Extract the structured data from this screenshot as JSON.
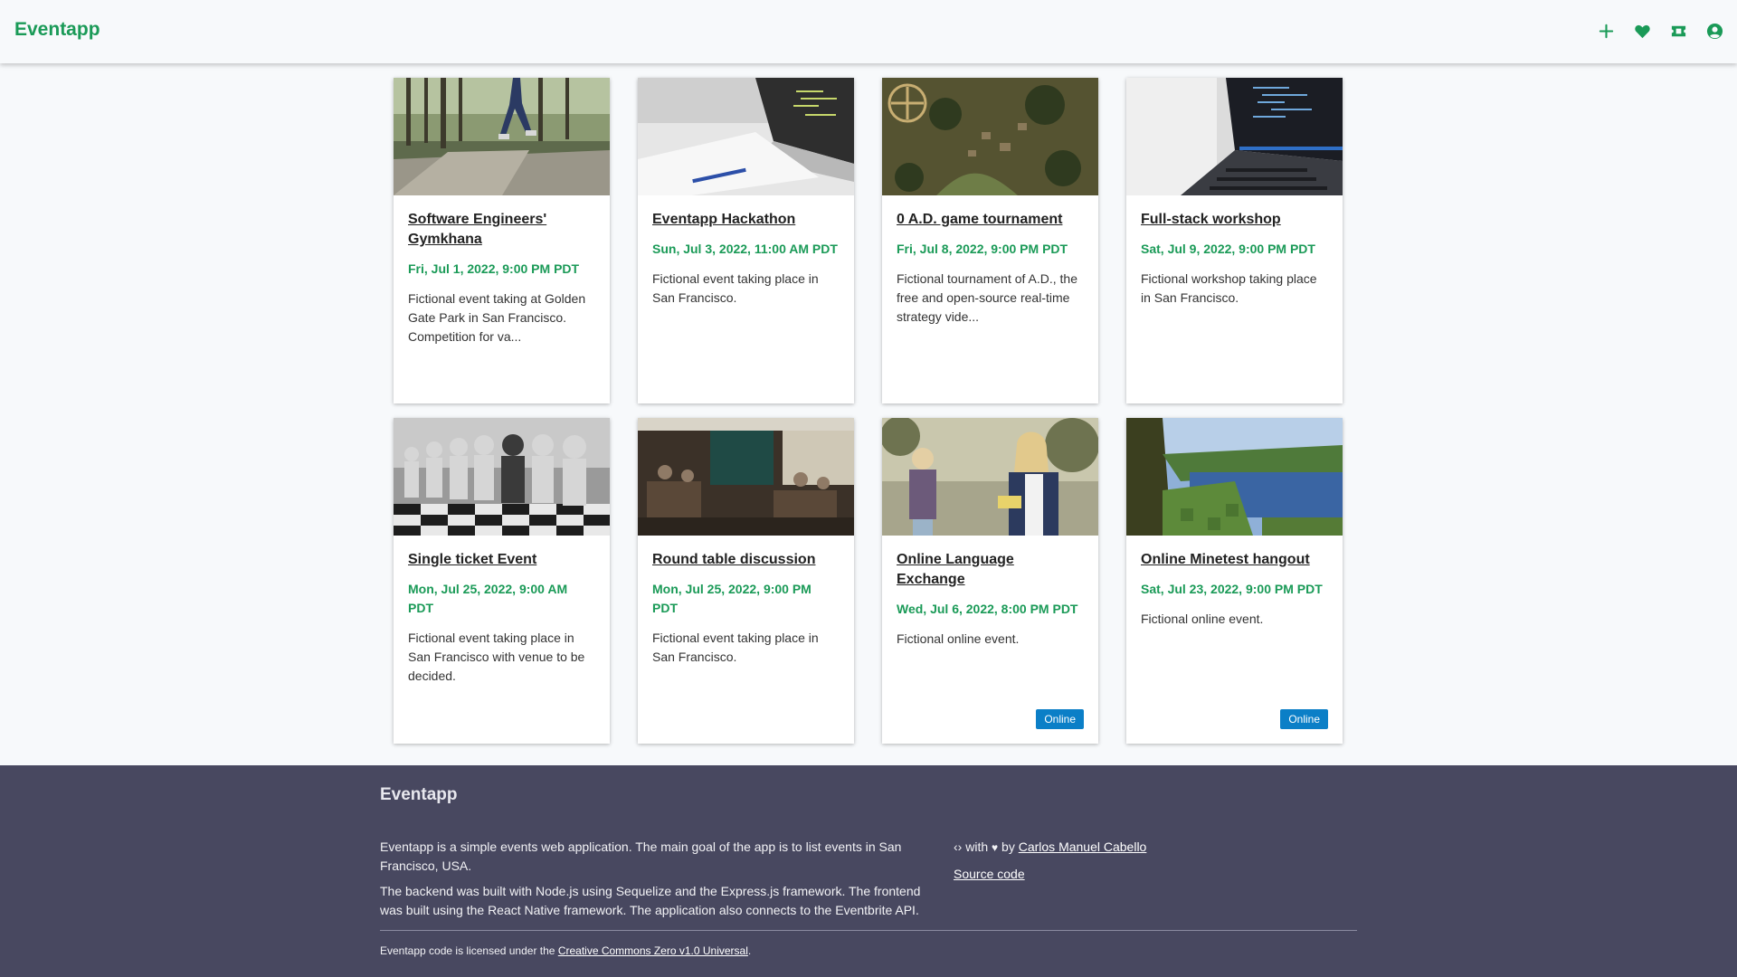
{
  "header": {
    "brand": "Eventapp",
    "icons": [
      "plus-icon",
      "heart-icon",
      "ticket-icon",
      "user-circle-icon"
    ]
  },
  "colors": {
    "accent": "#1a9a57",
    "badge": "#0b7fc7",
    "footer_bg": "#484860"
  },
  "events": [
    {
      "title": "Software Engineers' Gymkhana",
      "date": "Fri, Jul 1, 2022, 9:00 PM PDT",
      "description": "Fictional event taking at Golden Gate Park in San Francisco. Competition for va...",
      "badge": "",
      "image": "park-runner-image"
    },
    {
      "title": "Eventapp Hackathon",
      "date": "Sun, Jul 3, 2022, 11:00 AM PDT",
      "description": "Fictional event taking place in San Francisco.",
      "badge": "",
      "image": "laptop-notebook-image"
    },
    {
      "title": "0 A.D. game tournament",
      "date": "Fri, Jul 8, 2022, 9:00 PM PDT",
      "description": "Fictional tournament  of A.D., the free and open-source real-time strategy vide...",
      "badge": "",
      "image": "strategy-game-image"
    },
    {
      "title": "Full-stack workshop",
      "date": "Sat, Jul 9, 2022, 9:00 PM PDT",
      "description": "Fictional workshop taking place in San Francisco.",
      "badge": "",
      "image": "laptop-code-image"
    },
    {
      "title": "Single ticket Event",
      "date": "Mon, Jul 25, 2022, 9:00 AM PDT",
      "description": "Fictional event taking place in San Francisco with venue to be decided.",
      "badge": "",
      "image": "chess-pawns-image"
    },
    {
      "title": "Round table discussion",
      "date": "Mon, Jul 25, 2022, 9:00 PM PDT",
      "description": "Fictional event taking place in San Francisco.",
      "badge": "",
      "image": "cafe-interior-image"
    },
    {
      "title": "Online Language Exchange",
      "date": "Wed, Jul 6, 2022, 8:00 PM PDT",
      "description": "Fictional online event.",
      "badge": "Online",
      "image": "phone-call-image"
    },
    {
      "title": "Online Minetest hangout",
      "date": "Sat, Jul 23, 2022, 9:00 PM PDT",
      "description": "Fictional online event.",
      "badge": "Online",
      "image": "voxel-landscape-image"
    }
  ],
  "footer": {
    "title": "Eventapp",
    "about_1": "Eventapp is a simple events web application. The main goal of the app is to list events in San Francisco, USA.",
    "about_2": "The backend was built with Node.js using Sequelize and the Express.js framework. The frontend was built using the React Native framework. The application also connects to the Eventbrite API.",
    "made_with_prefix": "with",
    "made_by": "by",
    "author": "Carlos Manuel Cabello",
    "source_code": "Source code",
    "license_prefix": "Eventapp code is licensed under the",
    "license_link": "Creative Commons Zero v1.0 Universal",
    "license_suffix": "."
  }
}
